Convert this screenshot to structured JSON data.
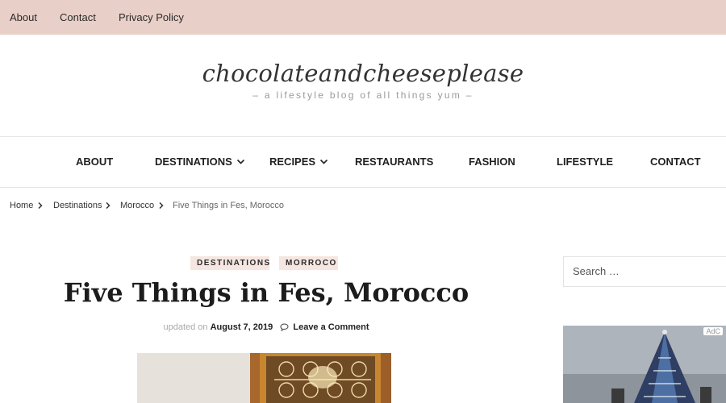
{
  "topbar": {
    "links": [
      "About",
      "Contact",
      "Privacy Policy"
    ],
    "background": "#e8cfc7"
  },
  "header": {
    "site_title": "chocolateandcheeseplease",
    "tagline": "– a lifestyle blog of all things yum –"
  },
  "nav": {
    "items": [
      {
        "label": "ABOUT",
        "has_dropdown": false
      },
      {
        "label": "DESTINATIONS",
        "has_dropdown": true
      },
      {
        "label": "RECIPES",
        "has_dropdown": true
      },
      {
        "label": "RESTAURANTS",
        "has_dropdown": false
      },
      {
        "label": "FASHION",
        "has_dropdown": false
      },
      {
        "label": "LIFESTYLE",
        "has_dropdown": false
      },
      {
        "label": "CONTACT",
        "has_dropdown": false
      }
    ],
    "dropdown_icon": "chevron-down-icon"
  },
  "breadcrumb": {
    "items": [
      "Home",
      "Destinations",
      "Morocco"
    ],
    "current": "Five Things in Fes, Morocco",
    "separator_icon": "chevron-right-icon"
  },
  "post": {
    "categories": [
      "DESTINATIONS",
      "MORROCO"
    ],
    "title": "Five Things in Fes, Morocco",
    "updated_prefix": "updated on",
    "date": "August 7, 2019",
    "comment_link": "Leave a Comment",
    "comment_icon": "speech-bubble-icon",
    "badge_color": "#f5e6e1"
  },
  "sidebar": {
    "search_placeholder": "Search …",
    "ad_label": "AdC"
  }
}
